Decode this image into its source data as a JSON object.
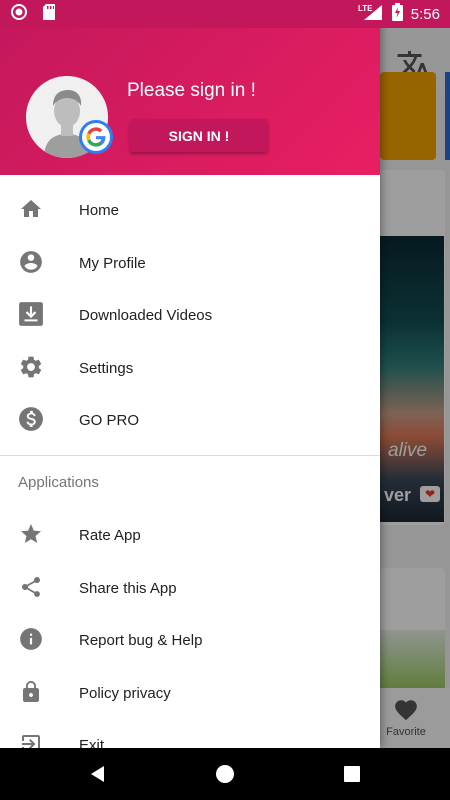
{
  "status_bar": {
    "time": "5:56",
    "network": "LTE"
  },
  "background_app": {
    "photo_text_line1": "alive",
    "photo_text_line2": "ver",
    "bottom_nav_favorite": "Favorite"
  },
  "drawer": {
    "header": {
      "prompt": "Please sign in !",
      "sign_in_button": "SIGN IN !"
    },
    "main_items": [
      {
        "label": "Home",
        "icon": "home-icon"
      },
      {
        "label": "My Profile",
        "icon": "account-circle-icon"
      },
      {
        "label": "Downloaded Videos",
        "icon": "download-icon"
      },
      {
        "label": "Settings",
        "icon": "gear-icon"
      },
      {
        "label": "GO PRO",
        "icon": "dollar-icon"
      }
    ],
    "section_title": "Applications",
    "app_items": [
      {
        "label": "Rate App",
        "icon": "star-icon"
      },
      {
        "label": "Share this App",
        "icon": "share-icon"
      },
      {
        "label": "Report bug & Help",
        "icon": "info-icon"
      },
      {
        "label": "Policy privacy",
        "icon": "lock-icon"
      },
      {
        "label": "Exit",
        "icon": "exit-icon"
      }
    ]
  },
  "colors": {
    "header_primary": "#c2185b",
    "header_secondary": "#e91e63",
    "icon_gray": "#757575"
  }
}
